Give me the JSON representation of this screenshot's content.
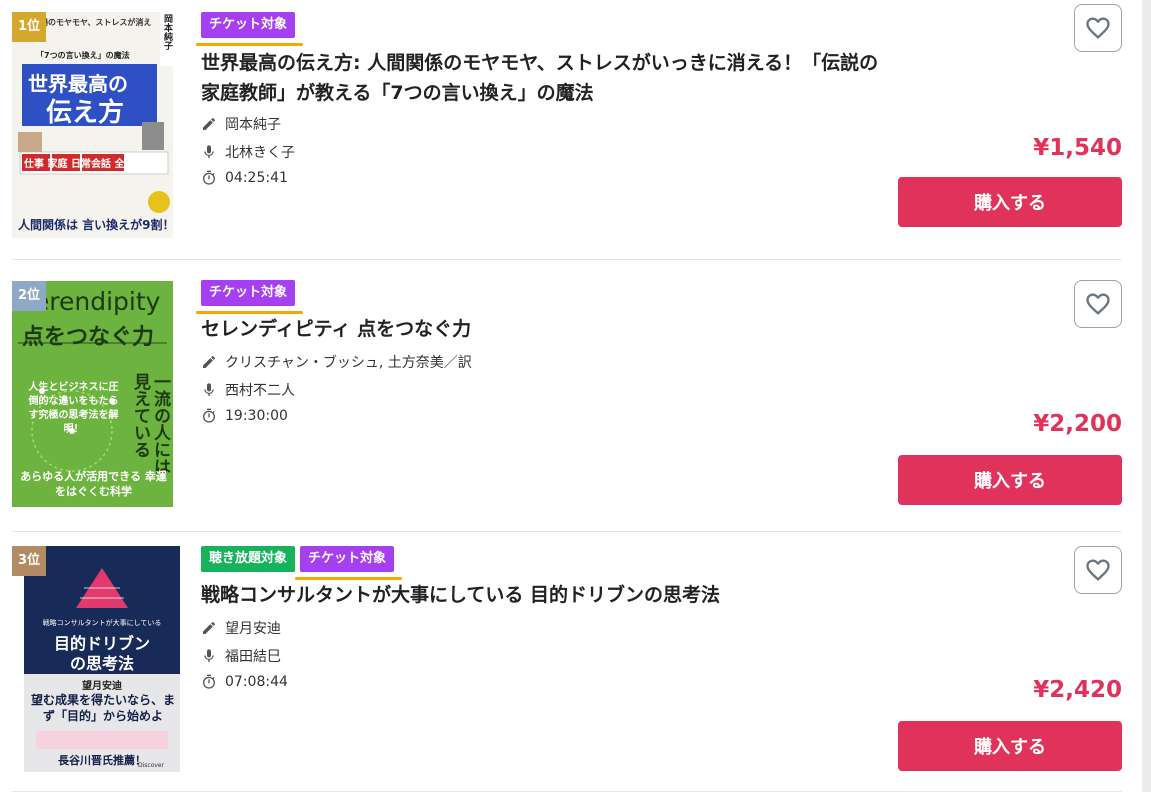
{
  "items": [
    {
      "rank": "1位",
      "rank_color": "#d4a82f",
      "badges": [
        {
          "type": "ticket",
          "label": "チケット対象"
        }
      ],
      "title": "世界最高の伝え方: 人間関係のモヤモヤ、ストレスがいっきに消える！「伝説の家庭教師」が教える「7つの言い換え」の魔法",
      "author": "岡本純子",
      "narrator": "北林きく子",
      "duration": "04:25:41",
      "price": "¥1,540",
      "buy_label": "購入する",
      "cover": {
        "top_text": "職場のモヤモヤ、ストレスが消える！",
        "subtitle": "「7つの言い換え」の魔法",
        "title_line1": "世界最高の",
        "title_line2": "伝え方",
        "author": "岡本純子",
        "tagline": "仕事 家庭 日常会話 全部使える！",
        "bottom": "人間関係は 言い換えが9割！"
      }
    },
    {
      "rank": "2位",
      "rank_color": "#8fa8c8",
      "badges": [
        {
          "type": "ticket",
          "label": "チケット対象"
        }
      ],
      "title": "セレンディピティ 点をつなぐ力",
      "author": "クリスチャン・ブッシュ, 土方奈美／訳",
      "narrator": "西村不二人",
      "duration": "19:30:00",
      "price": "¥2,200",
      "buy_label": "購入する",
      "cover": {
        "title_en": "Serendipity",
        "title_ja": "点をつなぐ力",
        "vertical": "一流の人には見えている",
        "mid": "人生とビジネスに圧倒的な違いをもたらす究極の思考法を解明！",
        "bottom": "あらゆる人が活用できる 幸運をはぐくむ科学"
      }
    },
    {
      "rank": "3位",
      "rank_color": "#b38b62",
      "badges": [
        {
          "type": "listen",
          "label": "聴き放題対象"
        },
        {
          "type": "ticket",
          "label": "チケット対象"
        }
      ],
      "title": "戦略コンサルタントが大事にしている 目的ドリブンの思考法",
      "author": "望月安迪",
      "narrator": "福田結巳",
      "duration": "07:08:44",
      "price": "¥2,420",
      "buy_label": "購入する",
      "cover": {
        "small": "戦略コンサルタントが大事にしている",
        "title_line1": "目的ドリブン",
        "title_line2": "の思考法",
        "author": "望月安迪",
        "main": "望む成果を得たいなら、まず「目的」から始めよ",
        "promo": "長谷川晋氏推薦！",
        "publisher": "Discover"
      }
    }
  ],
  "colors": {
    "price": "#e0325a",
    "buy": "#e0325a",
    "ticket": "#a63ff0",
    "listen": "#17b35c",
    "underline": "#f2a900"
  },
  "icons": [
    "pencil-icon",
    "microphone-icon",
    "timer-icon",
    "heart-icon"
  ]
}
